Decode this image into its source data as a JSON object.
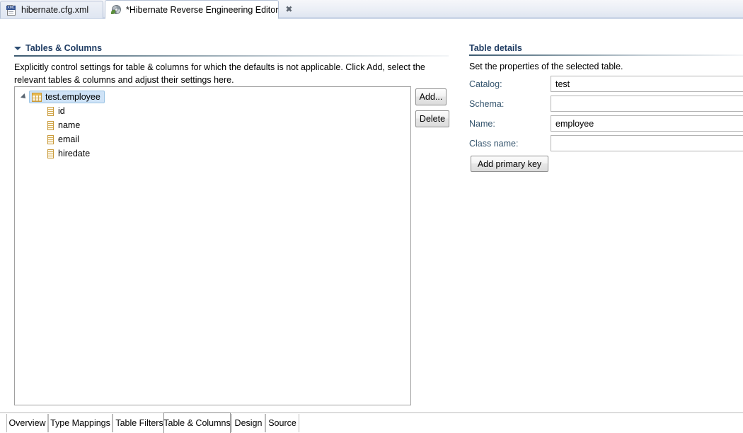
{
  "editor_tabs": [
    {
      "label": "hibernate.cfg.xml",
      "icon": "xml-file-icon",
      "active": false,
      "closable": false,
      "badge": "XML"
    },
    {
      "label": "*Hibernate Reverse Engineering Editor",
      "icon": "hibernate-icon",
      "active": true,
      "closable": true,
      "close_glyph": "✖"
    }
  ],
  "left_section": {
    "title": "Tables & Columns",
    "collapse_icon": "triangle-down-icon",
    "description": "Explicitly control settings for table & columns for which the defaults is not applicable. Click Add, select the relevant tables & columns and adjust their settings here.",
    "tree": {
      "root": {
        "label": "test.employee",
        "icon": "table-icon",
        "expanded": true,
        "selected": true,
        "expand_icon": "triangle-expanded-icon"
      },
      "children": [
        {
          "label": "id",
          "icon": "column-icon"
        },
        {
          "label": "name",
          "icon": "column-icon"
        },
        {
          "label": "email",
          "icon": "column-icon"
        },
        {
          "label": "hiredate",
          "icon": "column-icon"
        }
      ]
    },
    "buttons": {
      "add": "Add...",
      "delete": "Delete"
    }
  },
  "right_section": {
    "title": "Table details",
    "description": "Set the properties of the selected table.",
    "fields": [
      {
        "label": "Catalog:",
        "value": "test",
        "placeholder": ""
      },
      {
        "label": "Schema:",
        "value": "",
        "placeholder": ""
      },
      {
        "label": "Name:",
        "value": "employee",
        "placeholder": ""
      },
      {
        "label": "Class name:",
        "value": "",
        "placeholder": ""
      }
    ],
    "add_primary_key_button": "Add primary key"
  },
  "bottom_tabs": [
    {
      "label": "Overview",
      "active": false
    },
    {
      "label": "Type Mappings",
      "active": false
    },
    {
      "label": "Table Filters",
      "active": false
    },
    {
      "label": "Table & Columns",
      "active": true
    },
    {
      "label": "Design",
      "active": false
    },
    {
      "label": "Source",
      "active": false
    }
  ],
  "colors": {
    "section_title": "#1f3c63",
    "field_label": "#35556e",
    "selection": "#cfe3f7",
    "tab_strip": "#dde4f0",
    "icon_gold": "#c89a3c"
  }
}
